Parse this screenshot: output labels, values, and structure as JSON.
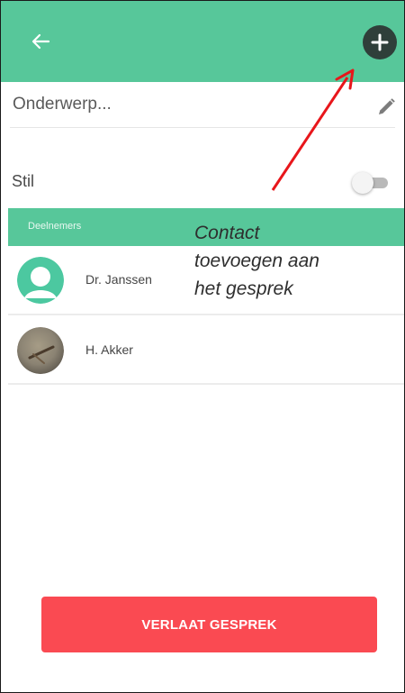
{
  "appbar": {
    "back_icon": "arrow-left-icon",
    "add_icon": "plus-circle-icon",
    "color": "#57c79a"
  },
  "subject": {
    "placeholder": "Onderwerp...",
    "edit_icon": "pencil-icon"
  },
  "silent": {
    "label": "Stil",
    "toggle_on": false
  },
  "participants": {
    "header": "Deelnemers",
    "items": [
      {
        "name": "Dr. Janssen",
        "avatar": "generic-avatar-icon"
      },
      {
        "name": "H. Akker",
        "avatar": "photo-avatar"
      }
    ]
  },
  "actions": {
    "leave_label": "VERLAAT GESPREK",
    "leave_color": "#fa4a52"
  },
  "annotation": {
    "line1": "Contact",
    "line2": "toevoegen aan",
    "line3": "het gesprek",
    "color": "#e8161b"
  }
}
